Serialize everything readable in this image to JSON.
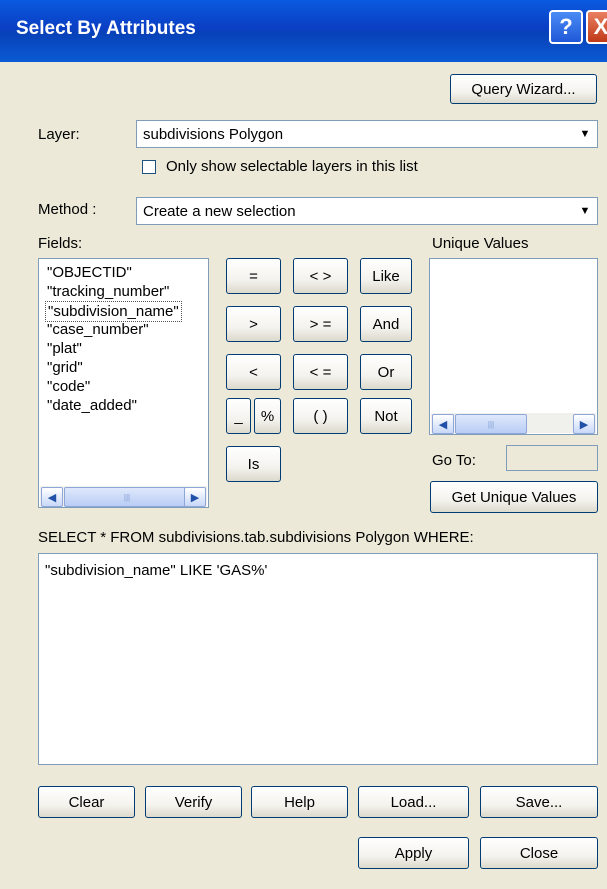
{
  "window": {
    "title": "Select By Attributes",
    "help_glyph": "?",
    "close_glyph": "X"
  },
  "query_wizard_label": "Query Wizard...",
  "layer": {
    "label": "Layer:",
    "value": "subdivisions Polygon",
    "only_selectable_label": "Only show selectable layers in this list",
    "only_selectable_checked": false
  },
  "method": {
    "label": "Method :",
    "value": "Create a new selection"
  },
  "fields": {
    "label": "Fields:",
    "items": [
      "\"OBJECTID\"",
      "\"tracking_number\"",
      "\"subdivision_name\"",
      "\"case_number\"",
      "\"plat\"",
      "\"grid\"",
      "\"code\"",
      "\"date_added\""
    ],
    "selected_index": 2
  },
  "operators": {
    "eq": "=",
    "ne": "< >",
    "like": "Like",
    "gt": ">",
    "ge": "> =",
    "and": "And",
    "lt": "<",
    "le": "< =",
    "or": "Or",
    "underscore": "_",
    "percent": "%",
    "parens": "( )",
    "not": "Not",
    "is": "Is"
  },
  "unique_values": {
    "label": "Unique Values",
    "goto_label": "Go To:",
    "goto_value": "",
    "get_button": "Get Unique Values"
  },
  "query": {
    "prefix": "SELECT * FROM subdivisions.tab.subdivisions Polygon WHERE:",
    "text": "\"subdivision_name\" LIKE 'GAS%'"
  },
  "buttons": {
    "clear": "Clear",
    "verify": "Verify",
    "help": "Help",
    "load": "Load...",
    "save": "Save...",
    "apply": "Apply",
    "close": "Close"
  },
  "scroll": {
    "left": "◀",
    "right": "▶",
    "grip": "|||",
    "dropdown": "▼"
  }
}
